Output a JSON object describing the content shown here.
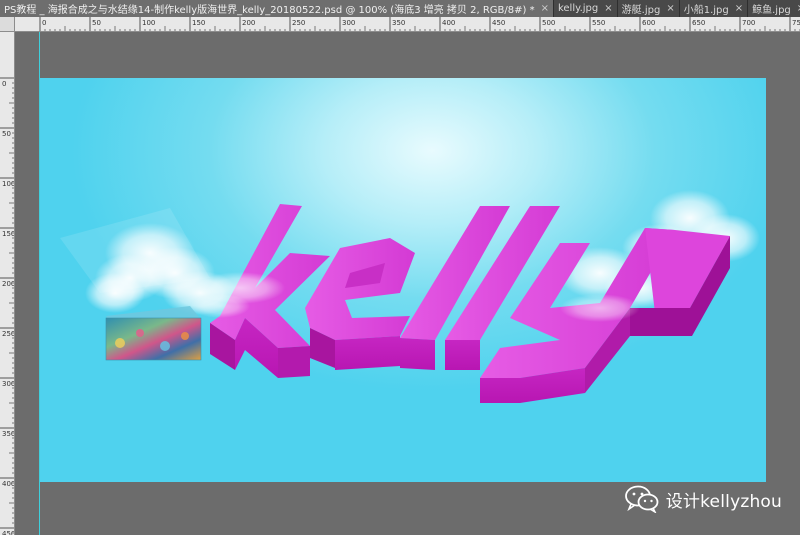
{
  "tabs": [
    {
      "label": "PS教程 _ 海报合成之与水结缘14-制作kelly版海世界_kelly_20180522.psd @ 100% (海底3 增亮 拷贝 2, RGB/8#) *",
      "active": true
    },
    {
      "label": "kelly.jpg",
      "active": false
    },
    {
      "label": "游艇.jpg",
      "active": false
    },
    {
      "label": "小船1.jpg",
      "active": false
    },
    {
      "label": "鲸鱼.jpg",
      "active": false
    }
  ],
  "tab_close_glyph": "×",
  "tab_overflow_glyph": "»",
  "ruler": {
    "top_labels": [
      "0",
      "50",
      "100",
      "150",
      "200",
      "250",
      "300",
      "350",
      "400",
      "450",
      "500",
      "550",
      "600",
      "650",
      "700",
      "750"
    ],
    "left_labels": [
      "0",
      "50",
      "100",
      "150",
      "200",
      "250",
      "300",
      "350",
      "400",
      "450"
    ]
  },
  "canvas": {
    "artwork_text": "kelly",
    "colors": {
      "sky_light": "#e8fbfe",
      "sky_mid": "#74dcf0",
      "sky_dark": "#4fd2ee",
      "letter_top": "#e24be0",
      "letter_front": "#c51fbf",
      "letter_side": "#a8159f"
    }
  },
  "watermark": {
    "icon": "wechat-icon",
    "text": "设计kellyzhou"
  }
}
